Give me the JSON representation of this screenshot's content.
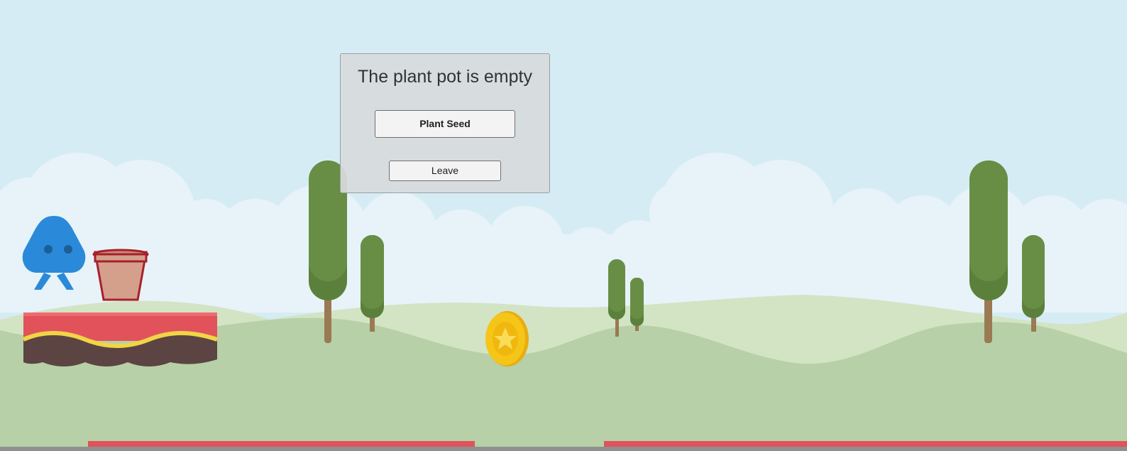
{
  "dialog": {
    "title": "The plant pot is empty",
    "plant_button_label": "Plant Seed",
    "leave_button_label": "Leave"
  },
  "colors": {
    "sky": "#d6ecf5",
    "clouds": "#e8f3f9",
    "hills_back": "#d3e4c5",
    "hills_front": "#b7d0a7",
    "tree_foliage": "#688e45",
    "tree_trunk": "#9a7a52",
    "platform_top": "#e1525b",
    "platform_stripe": "#f0d547",
    "platform_soil": "#5c4442",
    "player": "#2a8ad9",
    "pot": "#d4a08c",
    "pot_outline": "#a8202b",
    "coin": "#f5c518"
  },
  "icons": [
    "player-character-icon",
    "plant-pot-icon",
    "coin-icon",
    "tree-icon"
  ]
}
